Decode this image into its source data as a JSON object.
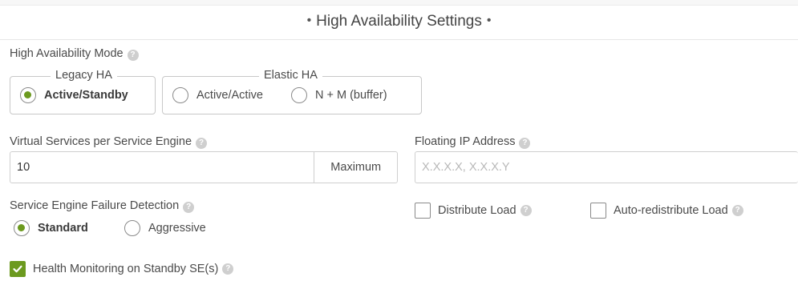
{
  "title": "High Availability Settings",
  "ha_mode": {
    "label": "High Availability Mode",
    "legacy_group": "Legacy HA",
    "elastic_group": "Elastic HA",
    "options": [
      {
        "label": "Active/Standby",
        "checked": true
      },
      {
        "label": "Active/Active",
        "checked": false
      },
      {
        "label": "N + M (buffer)",
        "checked": false
      }
    ]
  },
  "virtual_services": {
    "label": "Virtual Services per Service Engine",
    "value": "10",
    "addon": "Maximum"
  },
  "floating_ip": {
    "label": "Floating IP Address",
    "placeholder": "X.X.X.X, X.X.X.Y"
  },
  "failure_detection": {
    "label": "Service Engine Failure Detection",
    "options": [
      {
        "label": "Standard",
        "checked": true
      },
      {
        "label": "Aggressive",
        "checked": false
      }
    ]
  },
  "distribute_load": {
    "label": "Distribute Load",
    "checked": false
  },
  "auto_redistribute": {
    "label": "Auto-redistribute Load",
    "checked": false
  },
  "health_monitoring": {
    "label": "Health Monitoring on Standby SE(s)",
    "checked": true
  },
  "help_glyph": "?",
  "title_dot": "•",
  "colors": {
    "accent": "#6c9a1f",
    "help_icon": "#cfcfcf",
    "border": "#c8c8c8"
  }
}
